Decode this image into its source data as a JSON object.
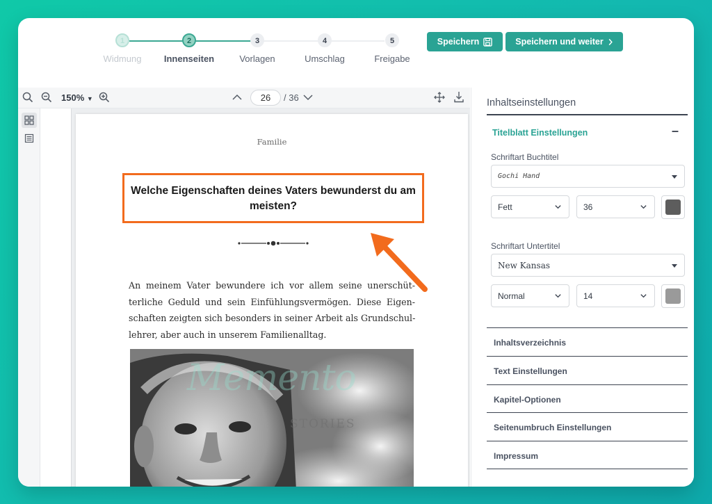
{
  "stepper": {
    "steps": [
      {
        "num": "1",
        "label": "Widmung"
      },
      {
        "num": "2",
        "label": "Innenseiten"
      },
      {
        "num": "3",
        "label": "Vorlagen"
      },
      {
        "num": "4",
        "label": "Umschlag"
      },
      {
        "num": "5",
        "label": "Freigabe"
      }
    ]
  },
  "actions": {
    "save_label": "Speichern",
    "save_continue_label": "Speichern und weiter"
  },
  "toolbar": {
    "zoom": "150%",
    "current_page": "26",
    "total_pages": "/ 36"
  },
  "page": {
    "header": "Familie",
    "question": "Welche Eigenschaften deines Vaters bewunderst du am meisten?",
    "body_lines": [
      "An meinem Vater bewundere ich vor allem seine unerschüt-",
      "terliche Geduld und sein Einfühlungsvermögen. Diese Eigen-",
      "schaften zeigten sich besonders in seiner Arbeit als Grundschul-",
      "lehrer, aber auch in unserem Familienalltag."
    ],
    "watermark": "Memento",
    "watermark_sub": "STORIES"
  },
  "panel": {
    "title": "Inhaltseinstellungen",
    "section_title": "Titelblatt Einstellungen",
    "section_toggle": "–",
    "title_font_label": "Schriftart Buchtitel",
    "title_font": "Gochi Hand",
    "title_weight": "Fett",
    "title_size": "36",
    "title_color": "#5d5d5d",
    "subtitle_font_label": "Schriftart Untertitel",
    "subtitle_font": "New Kansas",
    "subtitle_weight": "Normal",
    "subtitle_size": "14",
    "subtitle_color": "#9a9a9a",
    "sections": [
      "Inhaltsverzeichnis",
      "Text Einstellungen",
      "Kapitel-Optionen",
      "Seitenumbruch Einstellungen",
      "Impressum"
    ]
  },
  "colors": {
    "accent": "#2aa394",
    "highlight": "#f26b1d",
    "background": "#13b8b0"
  }
}
